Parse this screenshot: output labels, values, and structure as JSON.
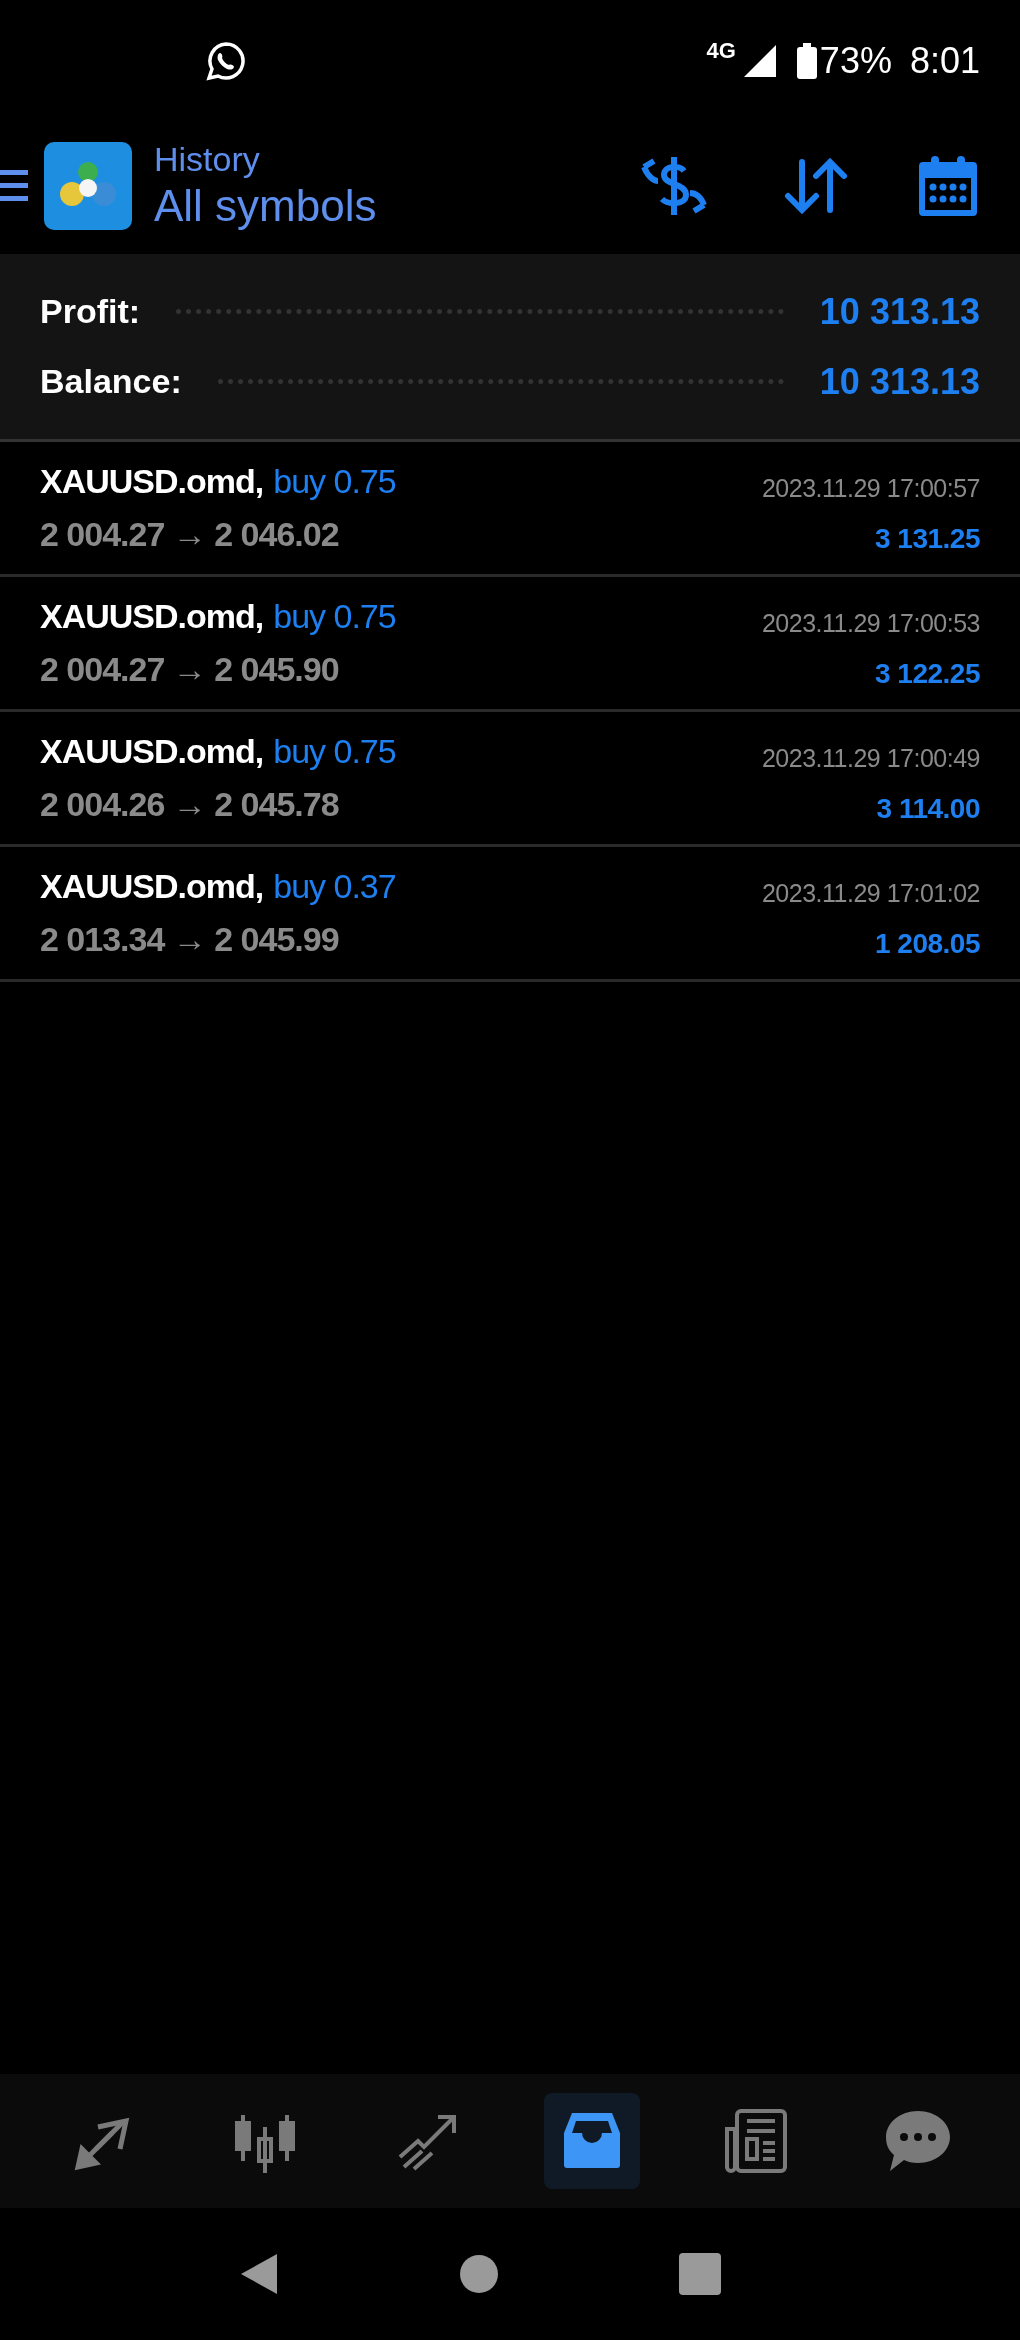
{
  "status_bar": {
    "network": "4G",
    "battery": "73%",
    "time": "8:01"
  },
  "header": {
    "subtitle": "History",
    "title": "All symbols"
  },
  "summary": [
    {
      "label": "Profit:",
      "value": "10 313.13"
    },
    {
      "label": "Balance:",
      "value": "10 313.13"
    }
  ],
  "deals": [
    {
      "symbol": "XAUUSD.omd,",
      "side": "buy 0.75",
      "prices": "2 004.27 → 2 046.02",
      "time": "2023.11.29 17:00:57",
      "profit": "3 131.25"
    },
    {
      "symbol": "XAUUSD.omd,",
      "side": "buy 0.75",
      "prices": "2 004.27 → 2 045.90",
      "time": "2023.11.29 17:00:53",
      "profit": "3 122.25"
    },
    {
      "symbol": "XAUUSD.omd,",
      "side": "buy 0.75",
      "prices": "2 004.26 → 2 045.78",
      "time": "2023.11.29 17:00:49",
      "profit": "3 114.00"
    },
    {
      "symbol": "XAUUSD.omd,",
      "side": "buy 0.37",
      "prices": "2 013.34 → 2 045.99",
      "time": "2023.11.29 17:01:02",
      "profit": "1 208.05"
    }
  ],
  "bottom_nav": [
    {
      "kind": "quotes",
      "selected": false
    },
    {
      "kind": "chart",
      "selected": false
    },
    {
      "kind": "trade",
      "selected": false
    },
    {
      "kind": "history",
      "selected": true
    },
    {
      "kind": "news",
      "selected": false
    },
    {
      "kind": "chat",
      "selected": false
    }
  ]
}
